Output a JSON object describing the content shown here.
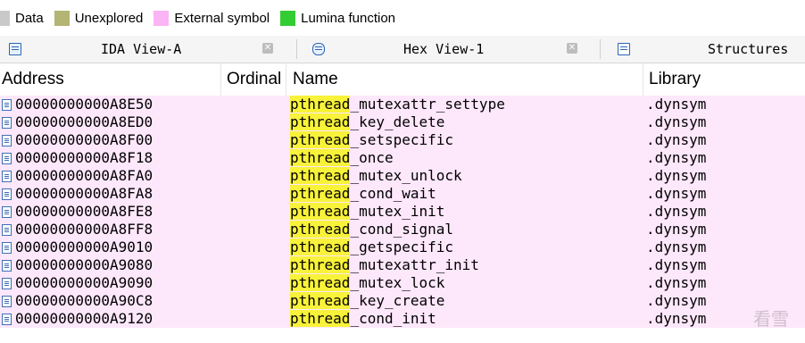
{
  "legend": [
    {
      "label": "Data",
      "color": "#c9c9c9"
    },
    {
      "label": "Unexplored",
      "color": "#b4b474"
    },
    {
      "label": "External symbol",
      "color": "#fbb4f5"
    },
    {
      "label": "Lumina function",
      "color": "#33cc33"
    }
  ],
  "tabs": [
    {
      "label": "IDA View-A",
      "icon": "ida-view-icon"
    },
    {
      "label": "Hex View-1",
      "icon": "hex-view-icon"
    },
    {
      "label": "Structures",
      "icon": "structures-icon"
    }
  ],
  "table": {
    "columns": [
      "Address",
      "Ordinal",
      "Name",
      "Library"
    ],
    "highlight_prefix": "pthread",
    "rows": [
      {
        "address": "00000000000A8E50",
        "prefix": "pthread",
        "suffix": "_mutexattr_settype",
        "library": ".dynsym"
      },
      {
        "address": "00000000000A8ED0",
        "prefix": "pthread",
        "suffix": "_key_delete",
        "library": ".dynsym"
      },
      {
        "address": "00000000000A8F00",
        "prefix": "pthread",
        "suffix": "_setspecific",
        "library": ".dynsym"
      },
      {
        "address": "00000000000A8F18",
        "prefix": "pthread",
        "suffix": "_once",
        "library": ".dynsym"
      },
      {
        "address": "00000000000A8FA0",
        "prefix": "pthread",
        "suffix": "_mutex_unlock",
        "library": ".dynsym"
      },
      {
        "address": "00000000000A8FA8",
        "prefix": "pthread",
        "suffix": "_cond_wait",
        "library": ".dynsym"
      },
      {
        "address": "00000000000A8FE8",
        "prefix": "pthread",
        "suffix": "_mutex_init",
        "library": ".dynsym"
      },
      {
        "address": "00000000000A8FF8",
        "prefix": "pthread",
        "suffix": "_cond_signal",
        "library": ".dynsym"
      },
      {
        "address": "00000000000A9010",
        "prefix": "pthread",
        "suffix": "_getspecific",
        "library": ".dynsym"
      },
      {
        "address": "00000000000A9080",
        "prefix": "pthread",
        "suffix": "_mutexattr_init",
        "library": ".dynsym"
      },
      {
        "address": "00000000000A9090",
        "prefix": "pthread",
        "suffix": "_mutex_lock",
        "library": ".dynsym"
      },
      {
        "address": "00000000000A90C8",
        "prefix": "pthread",
        "suffix": "_key_create",
        "library": ".dynsym"
      },
      {
        "address": "00000000000A9120",
        "prefix": "pthread",
        "suffix": "_cond_init",
        "library": ".dynsym"
      }
    ]
  },
  "colors": {
    "row_background": "#fde7fb",
    "highlight": "#f8f23a"
  },
  "watermark": "看雪"
}
